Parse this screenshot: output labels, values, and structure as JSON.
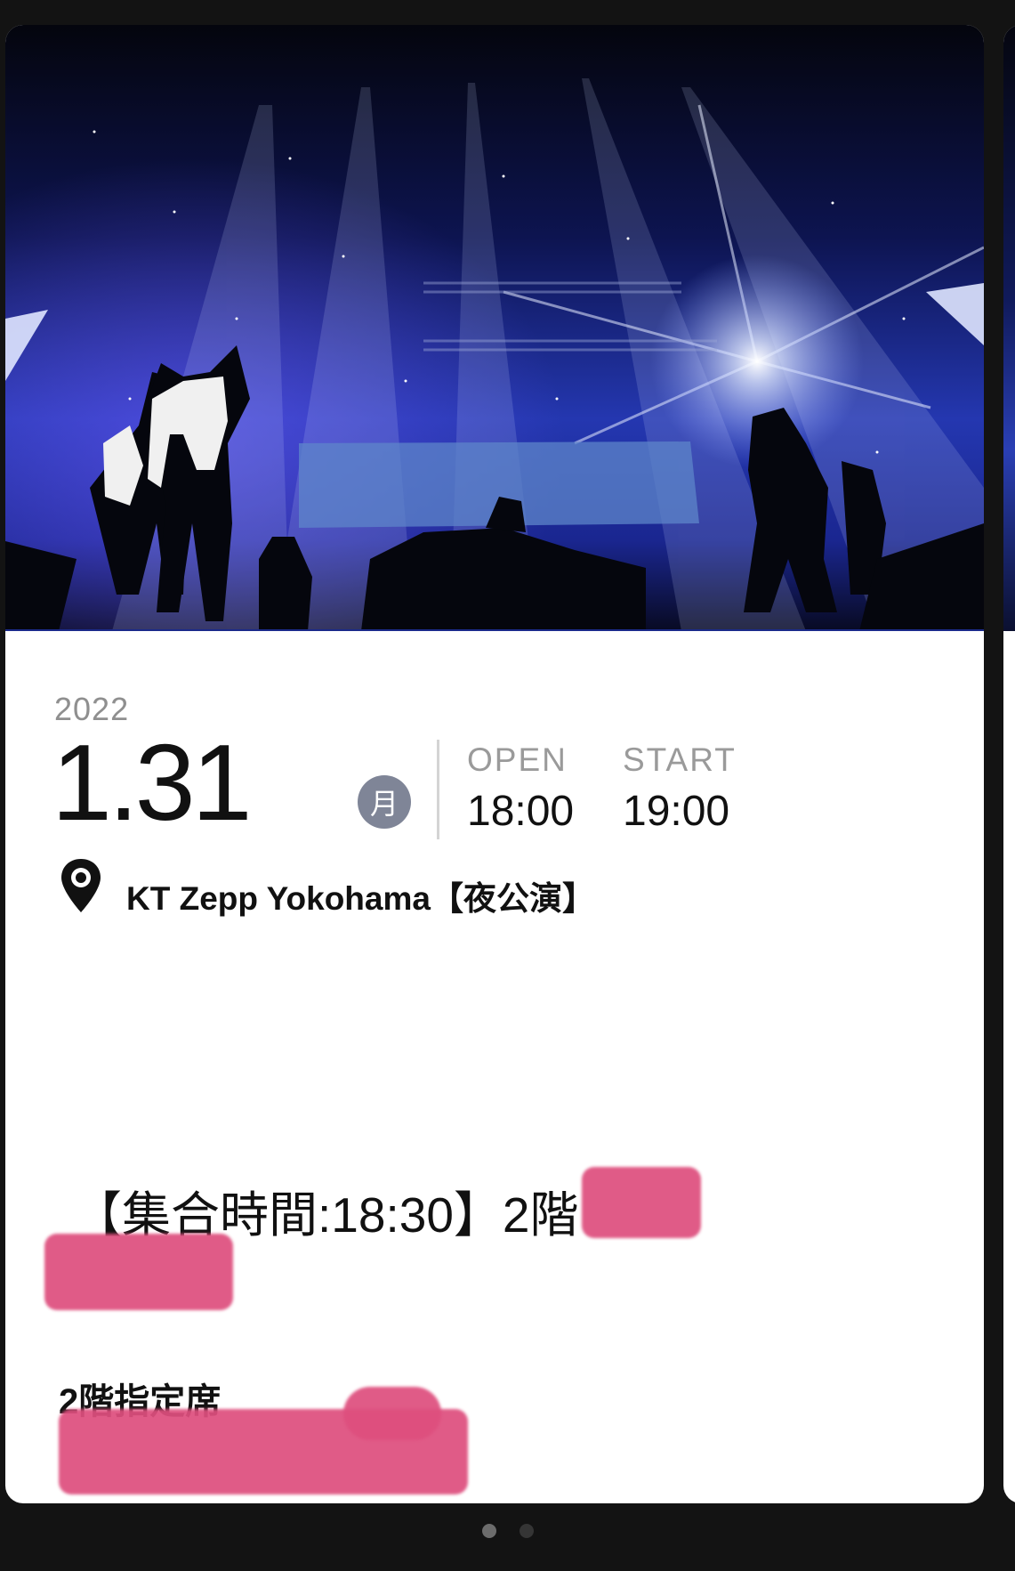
{
  "event": {
    "year": "2022",
    "date": "1.31",
    "weekday": "月",
    "open_label": "OPEN",
    "open_time": "18:00",
    "start_label": "START",
    "start_time": "19:00",
    "venue": "KT Zepp Yokohama【夜公演】"
  },
  "ticket": {
    "meeting_info": "【集合時間:18:30】2階",
    "seat_type": "2階指定席"
  },
  "pager": {
    "total": 2,
    "active_index": 0
  },
  "colors": {
    "weekday_badge": "#7f8597",
    "redaction": "#de4f7e",
    "background": "#131313"
  },
  "icons": {
    "venue": "map-pin-icon"
  }
}
